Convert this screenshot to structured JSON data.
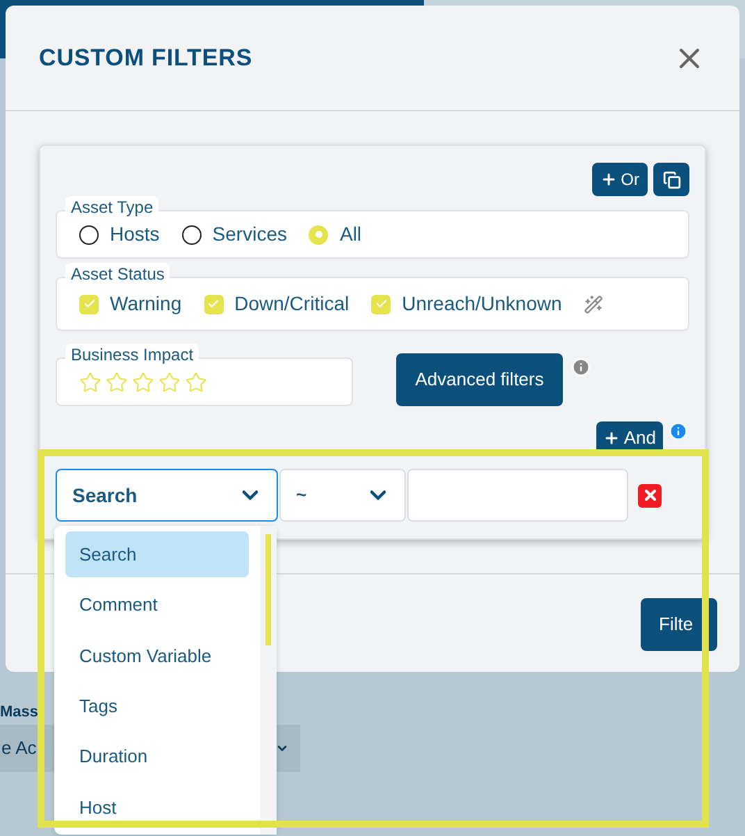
{
  "background": {
    "label": "Mass",
    "value": "e Ac"
  },
  "dialog": {
    "title": "CUSTOM FILTERS"
  },
  "group_buttons": [
    {
      "kind": "or",
      "label": "Or"
    },
    {
      "kind": "copy"
    }
  ],
  "asset_type": {
    "legend": "Asset Type",
    "options": [
      {
        "label": "Hosts",
        "selected": false
      },
      {
        "label": "Services",
        "selected": false
      },
      {
        "label": "All",
        "selected": true
      }
    ]
  },
  "asset_status": {
    "legend": "Asset Status",
    "options": [
      {
        "label": "Warning",
        "checked": true
      },
      {
        "label": "Down/Critical",
        "checked": true
      },
      {
        "label": "Unreach/Unknown",
        "checked": true
      }
    ]
  },
  "business_impact": {
    "legend": "Business Impact",
    "stars": 0
  },
  "advanced_button": "Advanced filters",
  "and_button": "And",
  "condition": {
    "field": "Search",
    "operator": "~"
  },
  "dropdown": {
    "items": [
      {
        "label": "Search",
        "selected": true
      },
      {
        "label": "Comment",
        "selected": false
      },
      {
        "label": "Custom Variable",
        "selected": false
      },
      {
        "label": "Tags",
        "selected": false
      },
      {
        "label": "Duration",
        "selected": false
      },
      {
        "label": "Host",
        "selected": false
      }
    ]
  },
  "filter_button": "Filte"
}
